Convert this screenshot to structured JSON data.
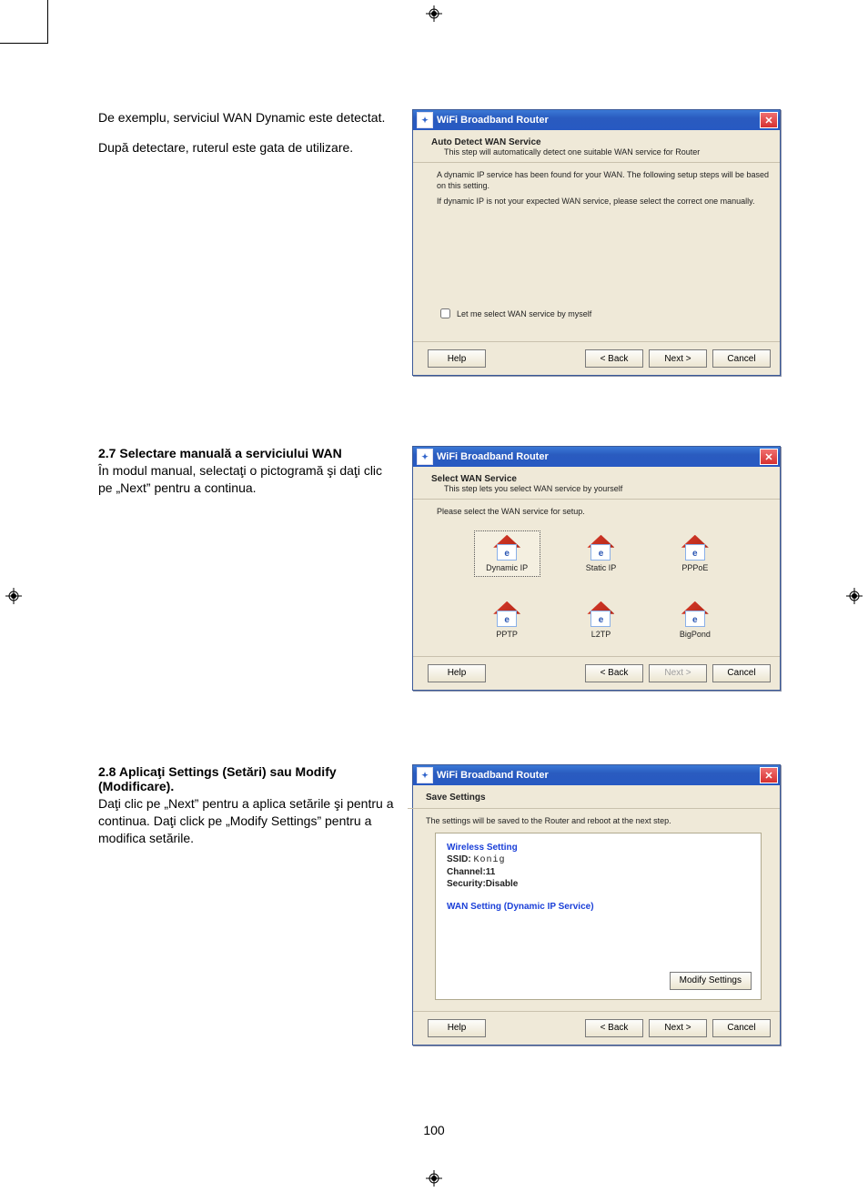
{
  "page_number": "100",
  "left_text": {
    "p1": "De exemplu, serviciul WAN Dynamic este detectat.",
    "p2": "După detectare, ruterul este gata de utilizare.",
    "h27": "2.7 Selectare manuală a serviciului WAN",
    "p27": "În modul manual, selectaţi o pictogramă şi daţi clic pe „Next” pentru a continua.",
    "h28": "2.8 Aplicaţi Settings (Setări) sau Modify (Modificare).",
    "p28": "Daţi clic pe „Next” pentru a aplica setările şi pentru a continua. Daţi click pe „Modify Settings” pentru a modifica setările."
  },
  "dialog_title": "WiFi Broadband Router",
  "buttons": {
    "help": "Help",
    "back": "< Back",
    "next": "Next >",
    "cancel": "Cancel"
  },
  "win1": {
    "section_title": "Auto Detect WAN Service",
    "section_sub": "This step will automatically detect one suitable WAN service for Router",
    "msg1": "A dynamic IP service has been found for your WAN. The following setup steps will be based on this setting.",
    "msg2": "If dynamic IP is not your expected WAN service, please select the correct one manually.",
    "checkbox_label": "Let me select WAN service by myself"
  },
  "win2": {
    "section_title": "Select WAN Service",
    "section_sub": "This step lets you select WAN service by yourself",
    "prompt": "Please select the WAN service for setup.",
    "services": [
      {
        "name": "Dynamic IP",
        "selected": true
      },
      {
        "name": "Static IP",
        "selected": false
      },
      {
        "name": "PPPoE",
        "selected": false
      },
      {
        "name": "PPTP",
        "selected": false
      },
      {
        "name": "L2TP",
        "selected": false
      },
      {
        "name": "BigPond",
        "selected": false
      }
    ]
  },
  "win3": {
    "section_title": "Save Settings",
    "msg": "The settings will be saved to the Router and reboot at the next step.",
    "wireless_head": "Wireless Setting",
    "ssid_label": "SSID:",
    "ssid_value": "Konig",
    "channel": "Channel:11",
    "security": "Security:Disable",
    "wan_head": "WAN Setting  (Dynamic IP Service)",
    "modify": "Modify Settings"
  }
}
